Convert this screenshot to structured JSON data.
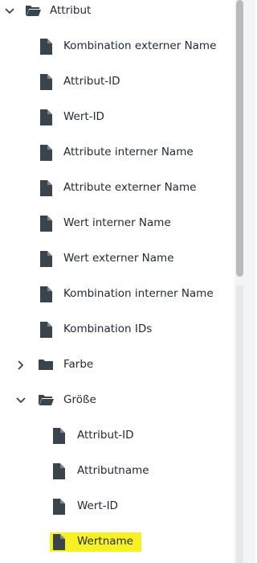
{
  "tree": {
    "items": [
      {
        "label": "Attribut",
        "kind": "folder-open",
        "expander": "chevron-down"
      },
      {
        "label": "Kombination externer Name",
        "kind": "file"
      },
      {
        "label": "Attribut-ID",
        "kind": "file"
      },
      {
        "label": "Wert-ID",
        "kind": "file"
      },
      {
        "label": "Attribute interner Name",
        "kind": "file"
      },
      {
        "label": "Attribute externer Name",
        "kind": "file"
      },
      {
        "label": "Wert interner Name",
        "kind": "file"
      },
      {
        "label": "Wert externer Name",
        "kind": "file"
      },
      {
        "label": "Kombination interner Name",
        "kind": "file"
      },
      {
        "label": "Kombination IDs",
        "kind": "file"
      },
      {
        "label": "Farbe",
        "kind": "folder",
        "expander": "chevron-right"
      },
      {
        "label": "Größe",
        "kind": "folder-open",
        "expander": "chevron-down"
      },
      {
        "label": "Attribut-ID",
        "kind": "file"
      },
      {
        "label": "Attributname",
        "kind": "file"
      },
      {
        "label": "Wert-ID",
        "kind": "file"
      },
      {
        "label": "Wertname",
        "kind": "file",
        "highlighted": true
      }
    ]
  },
  "colors": {
    "icon": "#3a444c",
    "text": "#1f2933",
    "highlight": "#f7f21f",
    "scrollbar_thumb": "#b7b9bb"
  }
}
